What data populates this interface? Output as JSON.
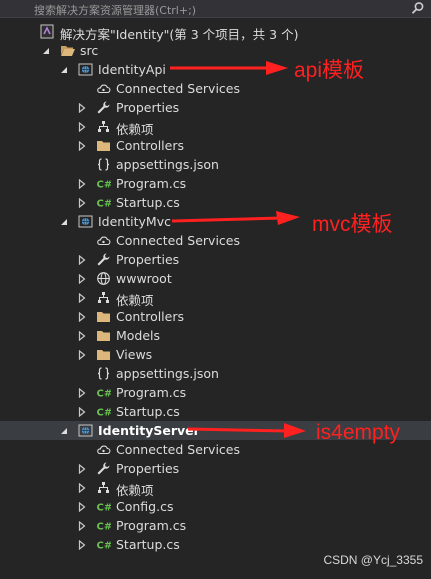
{
  "search": {
    "placeholder": "搜索解决方案资源管理器(Ctrl+;)"
  },
  "solution": {
    "label": "解决方案\"Identity\"(第 3 个项目，共 3 个)"
  },
  "folder": {
    "label": "src"
  },
  "projects": [
    {
      "name": "IdentityApi",
      "children": [
        "Connected Services",
        "Properties",
        "依赖项",
        "Controllers",
        "appsettings.json",
        "Program.cs",
        "Startup.cs"
      ]
    },
    {
      "name": "IdentityMvc",
      "children": [
        "Connected Services",
        "Properties",
        "wwwroot",
        "依赖项",
        "Controllers",
        "Models",
        "Views",
        "appsettings.json",
        "Program.cs",
        "Startup.cs"
      ]
    },
    {
      "name": "IdentityServer",
      "children": [
        "Connected Services",
        "Properties",
        "依赖项",
        "Config.cs",
        "Program.cs",
        "Startup.cs"
      ]
    }
  ],
  "annotations": [
    "api模板",
    "mvc模板",
    "is4empty"
  ],
  "watermark": "CSDN @Ycj_3355",
  "colors": {
    "annotation": "#ff2020",
    "folder": "#dcb67a",
    "csharp": "#68c050",
    "globe": "#4fa0e0"
  }
}
